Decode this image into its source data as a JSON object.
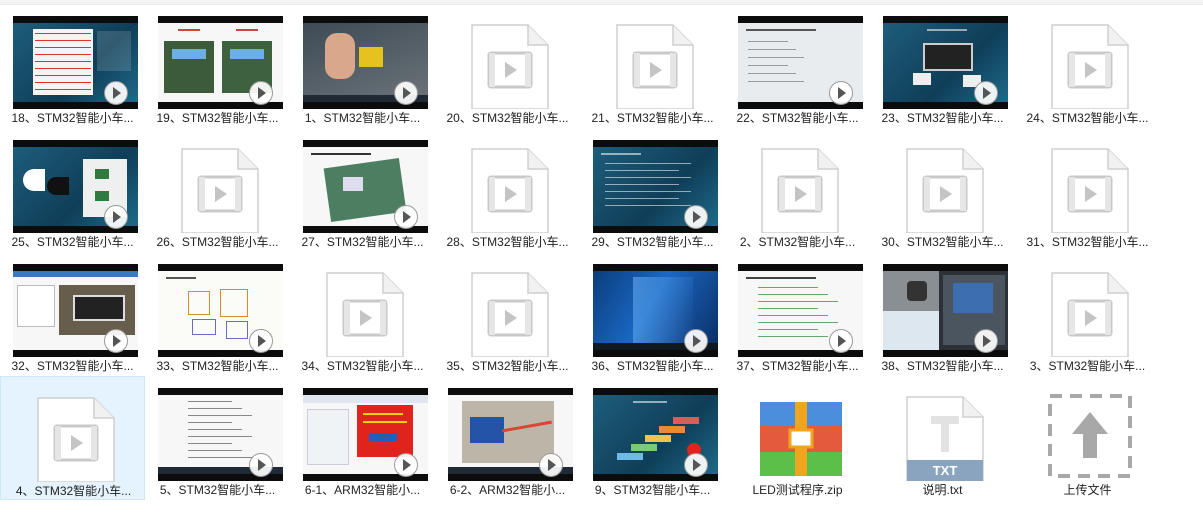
{
  "files": [
    {
      "name": "18、STM32智能小车...",
      "kind": "video",
      "scene": "teal-table"
    },
    {
      "name": "19、STM32智能小车...",
      "kind": "video",
      "scene": "boards"
    },
    {
      "name": "1、STM32智能小车...",
      "kind": "video",
      "scene": "hands"
    },
    {
      "name": "20、STM32智能小车...",
      "kind": "blank"
    },
    {
      "name": "21、STM32智能小车...",
      "kind": "blank"
    },
    {
      "name": "22、STM32智能小车...",
      "kind": "video",
      "scene": "slide-text"
    },
    {
      "name": "23、STM32智能小车...",
      "kind": "video",
      "scene": "teal-module"
    },
    {
      "name": "24、STM32智能小车...",
      "kind": "blank"
    },
    {
      "name": "25、STM32智能小车...",
      "kind": "video",
      "scene": "teal-sensors"
    },
    {
      "name": "26、STM32智能小车...",
      "kind": "blank"
    },
    {
      "name": "27、STM32智能小车...",
      "kind": "video",
      "scene": "slide-board"
    },
    {
      "name": "28、STM32智能小车...",
      "kind": "blank"
    },
    {
      "name": "29、STM32智能小车...",
      "kind": "video",
      "scene": "teal-text"
    },
    {
      "name": "2、STM32智能小车...",
      "kind": "blank"
    },
    {
      "name": "30、STM32智能小车...",
      "kind": "blank"
    },
    {
      "name": "31、STM32智能小车...",
      "kind": "blank"
    },
    {
      "name": "32、STM32智能小车...",
      "kind": "video",
      "scene": "phone"
    },
    {
      "name": "33、STM32智能小车...",
      "kind": "video",
      "scene": "sketch"
    },
    {
      "name": "34、STM32智能小车...",
      "kind": "blank"
    },
    {
      "name": "35、STM32智能小车...",
      "kind": "blank"
    },
    {
      "name": "36、STM32智能小车...",
      "kind": "video",
      "scene": "windows"
    },
    {
      "name": "37、STM32智能小车...",
      "kind": "video",
      "scene": "slide-lines"
    },
    {
      "name": "38、STM32智能小车...",
      "kind": "video",
      "scene": "desktop-robot"
    },
    {
      "name": "3、STM32智能小车...",
      "kind": "blank"
    },
    {
      "name": "4、STM32智能小车...",
      "kind": "blank",
      "selected": true
    },
    {
      "name": "5、STM32智能小车...",
      "kind": "video",
      "scene": "slide-list"
    },
    {
      "name": "6-1、ARM32智能小...",
      "kind": "video",
      "scene": "red-popup"
    },
    {
      "name": "6-2、ARM32智能小...",
      "kind": "video",
      "scene": "hand-board"
    },
    {
      "name": "9、STM32智能小车...",
      "kind": "video",
      "scene": "teal-steps"
    },
    {
      "name": "LED测试程序.zip",
      "kind": "zip"
    },
    {
      "name": "说明.txt",
      "kind": "txt",
      "ext_label": "TXT"
    },
    {
      "name": "上传文件",
      "kind": "upload"
    }
  ],
  "colors": {
    "zip_red": "#e45a3d",
    "zip_blue": "#4a8fd9",
    "zip_green": "#5bbf4a",
    "zip_orange": "#f0a51f",
    "txt_band": "#8aa4bf",
    "play_ring": "#ffffff"
  }
}
